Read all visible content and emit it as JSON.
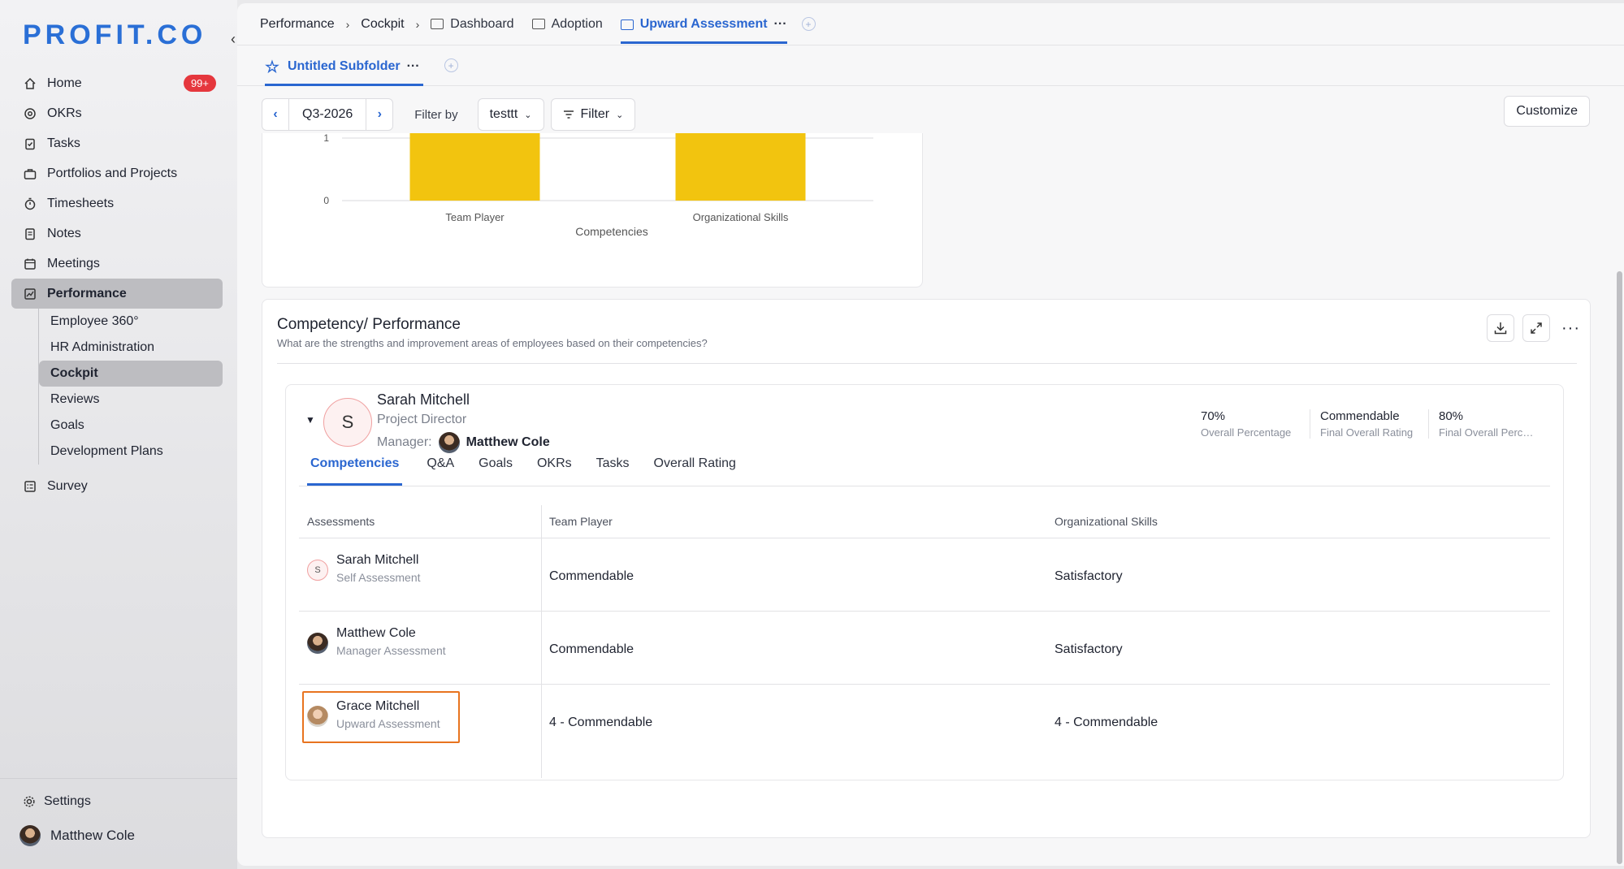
{
  "brand": "PROFIT.CO",
  "sidebar": {
    "items": [
      {
        "label": "Home",
        "icon": "home-icon",
        "badge": "99+"
      },
      {
        "label": "OKRs",
        "icon": "target-icon"
      },
      {
        "label": "Tasks",
        "icon": "clipboard-check-icon"
      },
      {
        "label": "Portfolios and Projects",
        "icon": "briefcase-icon"
      },
      {
        "label": "Timesheets",
        "icon": "stopwatch-icon"
      },
      {
        "label": "Notes",
        "icon": "notes-icon"
      },
      {
        "label": "Meetings",
        "icon": "calendar-icon"
      },
      {
        "label": "Performance",
        "icon": "chart-line-icon"
      }
    ],
    "performance_sub": [
      "Employee 360°",
      "HR Administration",
      "Cockpit",
      "Reviews",
      "Goals",
      "Development Plans"
    ],
    "survey": "Survey",
    "settings": "Settings",
    "user": "Matthew Cole"
  },
  "topbar": {
    "crumbs": [
      "Performance",
      "Cockpit"
    ],
    "tabs": [
      "Dashboard",
      "Adoption",
      "Upward Assessment"
    ],
    "active_tab_more": "···"
  },
  "subbar": {
    "tab": "Untitled Subfolder",
    "more": "···"
  },
  "filters": {
    "period": "Q3-2026",
    "filter_by": "Filter by",
    "dropdown": "testtt",
    "filter": "Filter",
    "customize": "Customize"
  },
  "chart_data": {
    "type": "bar",
    "categories": [
      "Team Player",
      "Organizational Skills"
    ],
    "values": [
      4,
      4
    ],
    "xlabel": "Competencies",
    "y_ticks_visible": [
      "1",
      "0"
    ],
    "color": "#f2c40f"
  },
  "competency": {
    "title": "Competency/ Performance",
    "subtitle": "What are the strengths and improvement areas of employees based on their competencies?",
    "person": {
      "initial": "S",
      "name": "Sarah Mitchell",
      "role": "Project Director",
      "manager_label": "Manager:",
      "manager": "Matthew Cole"
    },
    "stats": [
      {
        "value": "70%",
        "label": "Overall Percentage"
      },
      {
        "value": "Commendable",
        "label": "Final Overall Rating"
      },
      {
        "value": "80%",
        "label": "Final Overall Percen..."
      }
    ],
    "tabs": [
      "Competencies",
      "Q&A",
      "Goals",
      "OKRs",
      "Tasks",
      "Overall Rating"
    ],
    "table": {
      "headers": [
        "Assessments",
        "Team Player",
        "Organizational Skills"
      ],
      "rows": [
        {
          "initial": "S",
          "name": "Sarah Mitchell",
          "type": "Self Assessment",
          "team_player": "Commendable",
          "org_skills": "Satisfactory"
        },
        {
          "name": "Matthew Cole",
          "type": "Manager Assessment",
          "team_player": "Commendable",
          "org_skills": "Satisfactory"
        },
        {
          "name": "Grace Mitchell",
          "type": "Upward Assessment",
          "team_player": "4 - Commendable",
          "org_skills": "4 - Commendable"
        }
      ]
    }
  }
}
